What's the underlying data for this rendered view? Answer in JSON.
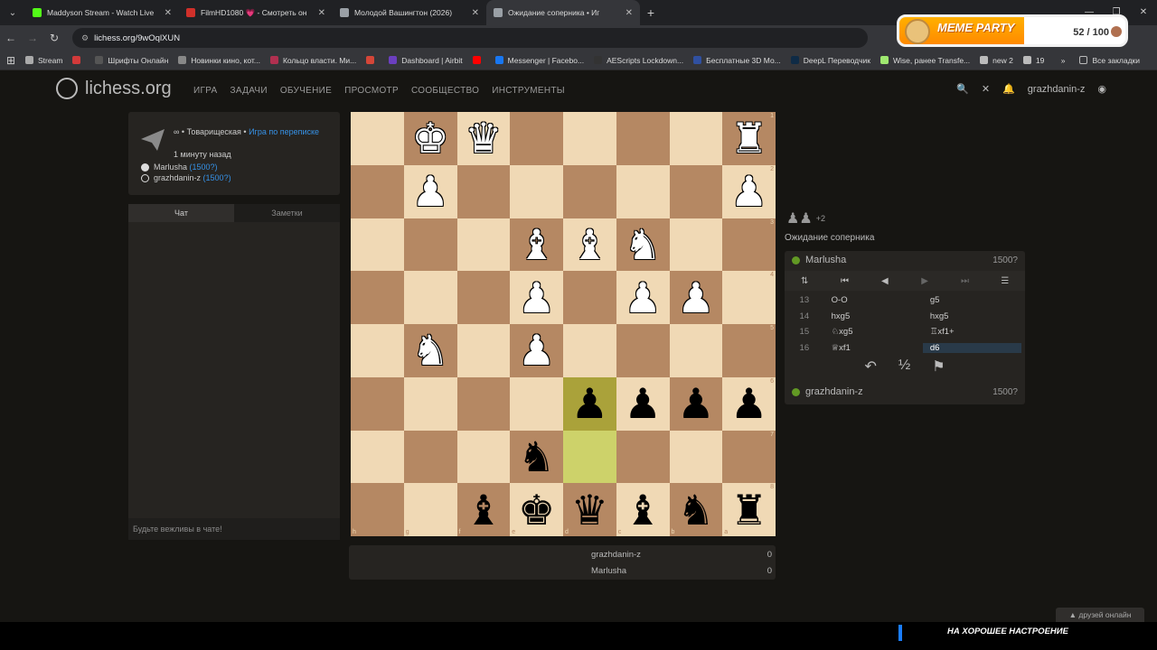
{
  "browser": {
    "tabs": [
      {
        "title": "Maddyson Stream - Watch Live",
        "color": "#53fc18"
      },
      {
        "title": "FilmHD1080 💗 - Смотреть он",
        "color": "#d0302a"
      },
      {
        "title": "Молодой Вашингтон (2026)",
        "color": "#9aa0a6"
      },
      {
        "title": "Ожидание соперника • Иг",
        "color": "#9aa0a6"
      }
    ],
    "url": "lichess.org/9wOqlXUN",
    "bookmarks": [
      {
        "label": "Stream",
        "color": "#aaaaaa"
      },
      {
        "label": "",
        "color": "#d23a3a"
      },
      {
        "label": "Шрифты Онлайн",
        "color": "#555555"
      },
      {
        "label": "Новинки кино, кот...",
        "color": "#888888"
      },
      {
        "label": "Кольцо власти. Ми...",
        "color": "#b03050"
      },
      {
        "label": "",
        "color": "#d44638"
      },
      {
        "label": "Dashboard | Airbit",
        "color": "#6b3fbf"
      },
      {
        "label": "",
        "color": "#ff0000"
      },
      {
        "label": "Messenger | Facebo...",
        "color": "#1877f2"
      },
      {
        "label": "AEScripts Lockdown...",
        "color": "#333333"
      },
      {
        "label": "Бесплатные 3D Мо...",
        "color": "#3050a0"
      },
      {
        "label": "DeepL Переводчик",
        "color": "#0f2b46"
      },
      {
        "label": "Wise, ранее Transfe...",
        "color": "#9fe870"
      },
      {
        "label": "new 2",
        "color": "#bbbbbb"
      },
      {
        "label": "19",
        "color": "#bbbbbb"
      }
    ],
    "all_bookmarks": "Все закладки"
  },
  "meme_party": {
    "title": "MEME PARTY",
    "count": "52 / 100"
  },
  "site": {
    "logo": "lichess.org",
    "menu": [
      "ИГРА",
      "ЗАДАЧИ",
      "ОБУЧЕНИЕ",
      "ПРОСМОТР",
      "СООБЩЕСТВО",
      "ИНСТРУМЕНТЫ"
    ],
    "username": "grazhdanin-z"
  },
  "game_info": {
    "type_prefix": "∞ • Товарищеская •",
    "type_link": "Игра по переписке",
    "time": "1 минуту назад",
    "player1": "Marlusha",
    "player1_rating": "(1500?)",
    "player2": "grazhdanin-z",
    "player2_rating": "(1500?)"
  },
  "chat": {
    "tab_chat": "Чат",
    "tab_notes": "Заметки",
    "placeholder": "Будьте вежливы в чате!"
  },
  "board": {
    "rank_labels": [
      "1",
      "2",
      "3",
      "4",
      "5",
      "6",
      "7",
      "8"
    ],
    "file_labels": [
      "h",
      "g",
      "f",
      "e",
      "d",
      "c",
      "b",
      "a"
    ],
    "rows": [
      [
        "",
        "wK",
        "wQ",
        "",
        "",
        "",
        "",
        "wR"
      ],
      [
        "",
        "wP",
        "",
        "",
        "",
        "",
        "",
        "wP"
      ],
      [
        "",
        "",
        "",
        "wB",
        "wB",
        "wN",
        "",
        ""
      ],
      [
        "",
        "",
        "",
        "wP",
        "",
        "wP",
        "wP",
        ""
      ],
      [
        "",
        "wN",
        "",
        "wP",
        "",
        "",
        "",
        ""
      ],
      [
        "",
        "",
        "",
        "",
        "bP",
        "bP",
        "bP",
        "bP"
      ],
      [
        "",
        "",
        "",
        "bN",
        "",
        "",
        "",
        ""
      ],
      [
        "",
        "",
        "bB",
        "bK",
        "bQ",
        "bB",
        "bN",
        "bR"
      ]
    ],
    "highlight": [
      [
        5,
        4
      ],
      [
        6,
        4
      ]
    ]
  },
  "right": {
    "spectators": "+2",
    "waiting": "Ожидание соперника",
    "opponent": "Marlusha",
    "opponent_rating": "1500?",
    "me": "grazhdanin-z",
    "me_rating": "1500?",
    "moves": [
      {
        "n": "13",
        "w": "O-O",
        "b": "g5"
      },
      {
        "n": "14",
        "w": "hxg5",
        "b": "hxg5"
      },
      {
        "n": "15",
        "w": "♘xg5",
        "b": "♖xf1+"
      },
      {
        "n": "16",
        "w": "♕xf1",
        "b": "d6"
      }
    ]
  },
  "score": [
    {
      "name": "grazhdanin-z",
      "score": "0"
    },
    {
      "name": "Marlusha",
      "score": "0"
    }
  ],
  "friends": "друзей онлайн",
  "overlay": "НА ХОРОШЕЕ НАСТРОЕНИЕ"
}
